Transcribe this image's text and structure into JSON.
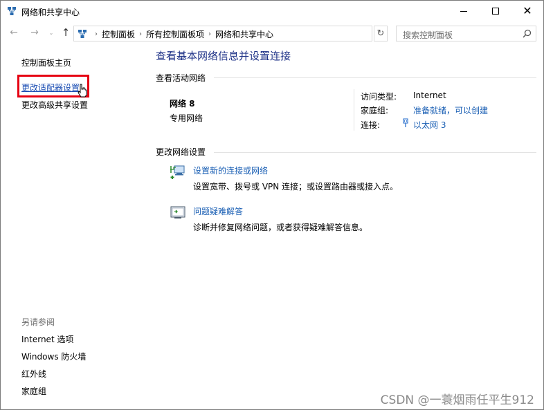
{
  "window": {
    "title": "网络和共享中心",
    "minimize_label": "",
    "maximize_label": "",
    "close_label": "✕"
  },
  "navigation": {
    "back_glyph": "←",
    "forward_glyph": "→",
    "recent_glyph": "⌄",
    "up_glyph": "↑",
    "breadcrumbs": [
      "控制面板",
      "所有控制面板项",
      "网络和共享中心"
    ],
    "refresh_glyph": "↻",
    "search_placeholder": "搜索控制面板"
  },
  "sidebar": {
    "home": "控制面板主页",
    "adapter_settings": "更改适配器设置",
    "advanced_sharing": "更改高级共享设置",
    "see_also_title": "另请参阅",
    "see_also": [
      "Internet 选项",
      "Windows 防火墙",
      "红外线",
      "家庭组"
    ]
  },
  "main": {
    "title": "查看基本网络信息并设置连接",
    "active_networks_heading": "查看活动网络",
    "network": {
      "name": "网络  8",
      "type": "专用网络",
      "access_type_label": "访问类型:",
      "access_type_value": "Internet",
      "homegroup_label": "家庭组:",
      "homegroup_value": "准备就绪，可以创建",
      "connection_label": "连接:",
      "connection_value": "以太网 3"
    },
    "change_settings_heading": "更改网络设置",
    "tasks": [
      {
        "title": "设置新的连接或网络",
        "description": "设置宽带、拨号或 VPN 连接；或设置路由器或接入点。"
      },
      {
        "title": "问题疑难解答",
        "description": "诊断并修复网络问题，或者获得疑难解答信息。"
      }
    ]
  },
  "colors": {
    "title_blue": "#1e3287",
    "link_blue": "#1a5fb4",
    "highlight_red": "#e60012",
    "watermark_gray": "#8a8a8a"
  },
  "watermark": "CSDN @一蓑烟雨任平生912"
}
